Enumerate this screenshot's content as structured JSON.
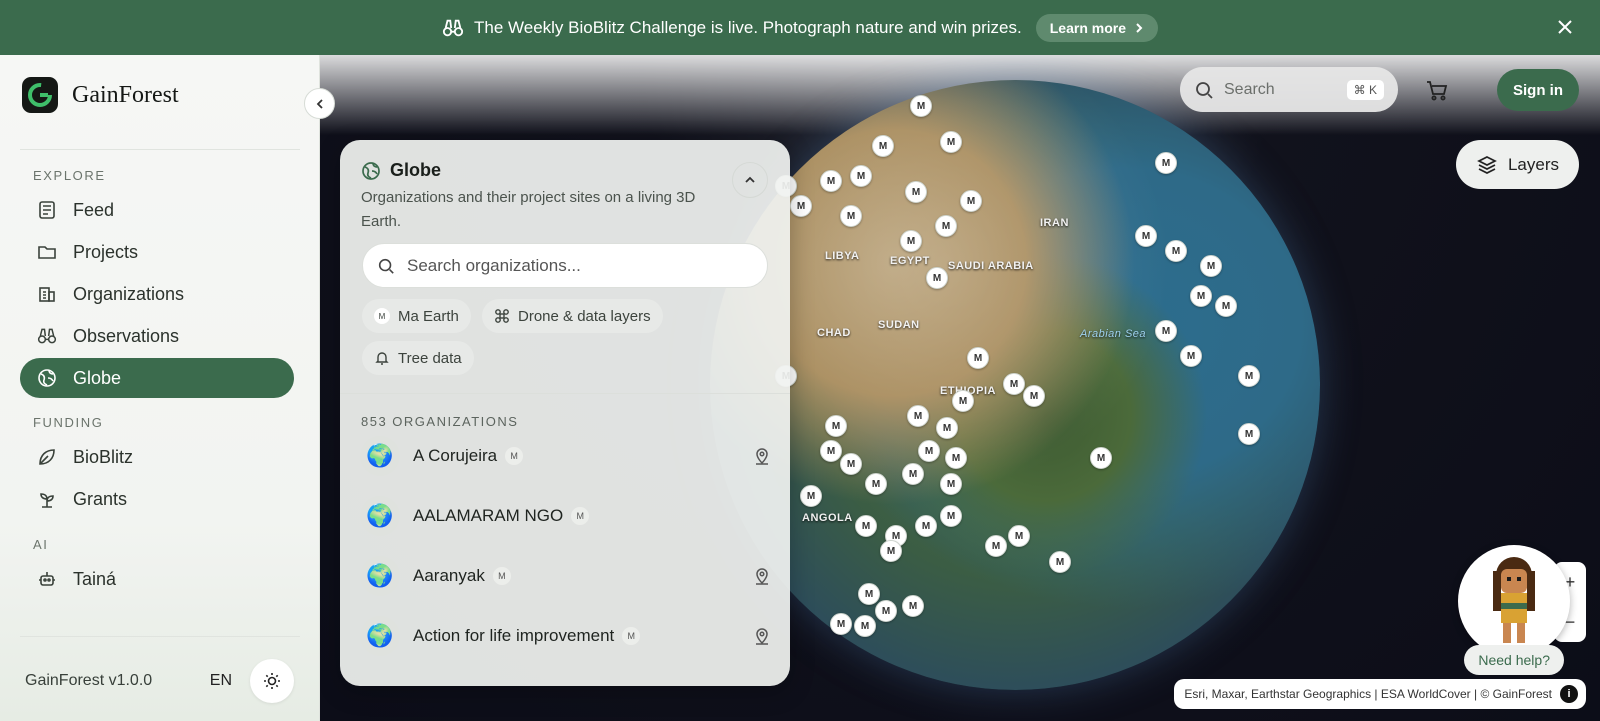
{
  "banner": {
    "message": "The Weekly BioBlitz Challenge is live. Photograph nature and win prizes.",
    "cta": "Learn more"
  },
  "brand": {
    "name": "GainForest"
  },
  "sidebar": {
    "sections": {
      "explore": "EXPLORE",
      "funding": "FUNDING",
      "ai": "AI"
    },
    "items": [
      {
        "label": "Feed",
        "icon": "feed-icon"
      },
      {
        "label": "Projects",
        "icon": "folder-icon"
      },
      {
        "label": "Organizations",
        "icon": "building-icon"
      },
      {
        "label": "Observations",
        "icon": "binoculars-icon"
      },
      {
        "label": "Globe",
        "icon": "globe-icon",
        "active": true
      },
      {
        "label": "BioBlitz",
        "icon": "leaf-icon"
      },
      {
        "label": "Grants",
        "icon": "sprout-icon"
      },
      {
        "label": "Tainá",
        "icon": "bot-icon"
      }
    ],
    "version": "GainForest v1.0.0",
    "language": "EN"
  },
  "topbar": {
    "search_placeholder": "Search",
    "shortcut": "⌘ K",
    "sign_in": "Sign in",
    "layers": "Layers"
  },
  "panel": {
    "title": "Globe",
    "description": "Organizations and their project sites on a living 3D Earth.",
    "search_placeholder": "Search organizations...",
    "chips": [
      "Ma Earth",
      "Drone & data layers",
      "Tree data"
    ],
    "count": "853 ORGANIZATIONS",
    "organizations": [
      {
        "name": "A Corujeira",
        "has_pin": true
      },
      {
        "name": "AALAMARAM NGO",
        "has_pin": false
      },
      {
        "name": "Aaranyak",
        "has_pin": true
      },
      {
        "name": "Action for life improvement",
        "has_pin": true
      }
    ]
  },
  "map": {
    "labels": [
      "LIBYA",
      "EGYPT",
      "SAUDI ARABIA",
      "CHAD",
      "SUDAN",
      "ETHIOPIA",
      "ANGOLA",
      "IRAN",
      "Arabian Sea"
    ],
    "attribution": "Esri, Maxar, Earthstar Geographics | ESA WorldCover | © GainForest"
  },
  "help": {
    "label": "Need help?"
  },
  "colors": {
    "brand_green": "#3b6b4d",
    "banner_bg": "#3b6b4d",
    "map_bg": "#0c0d18"
  }
}
